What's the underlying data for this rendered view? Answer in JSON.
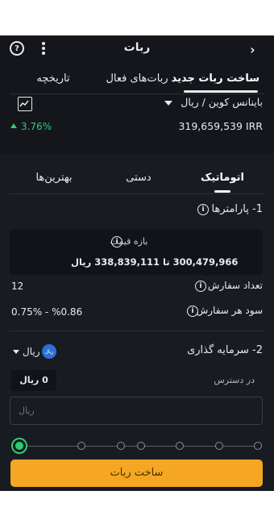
{
  "header": {
    "title": "ربات",
    "help_icon": "question-circle-icon",
    "menu_icon": "vertical-dots-icon",
    "back_icon": "chevron-right-icon"
  },
  "main_tabs": [
    {
      "label": "ساخت ربات جدید",
      "active": true
    },
    {
      "label": "ربات‌های فعال",
      "active": false
    },
    {
      "label": "تاریخچه",
      "active": false
    }
  ],
  "market": {
    "pair": "باینانس کوین / ریال",
    "price": "319,659,539 IRR",
    "change": "3.76%",
    "change_color": "#2ecc71"
  },
  "mode_tabs": [
    {
      "label": "اتوماتیک",
      "active": true
    },
    {
      "label": "دستی",
      "active": false
    },
    {
      "label": "بهترین‌ها",
      "active": false
    }
  ],
  "params": {
    "title": "1- پارامترها",
    "range_title": "بازه قیمت",
    "range_from": "300,479,966",
    "range_sep": "تا",
    "range_to": "338,839,111",
    "range_unit": "ریال",
    "order_count_label": "تعداد سفارش",
    "order_count_value": "12",
    "profit_label": "سود هر سفارش",
    "profit_value": "0.75% - %0.86"
  },
  "invest": {
    "title": "2- سرمایه گذاری",
    "currency": "ریال",
    "currency_badge": "ریال",
    "available_label": "در دسترس",
    "available_value": "0 ریال",
    "input_placeholder": "ریال"
  },
  "slider": {
    "value_fraction": 0,
    "stops": 7
  },
  "submit_label": "ساخت ربات",
  "colors": {
    "accent": "#f5a623",
    "background": "#14161b",
    "badge": "#2f6fd6"
  }
}
